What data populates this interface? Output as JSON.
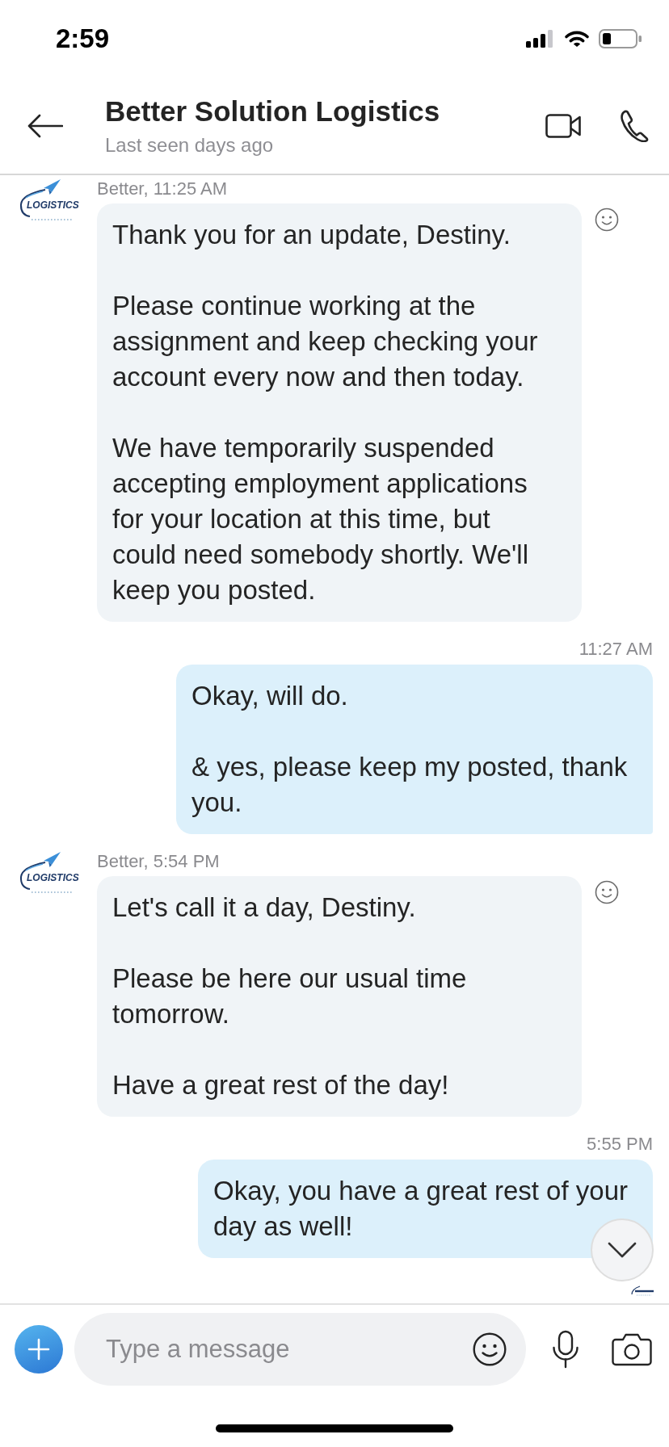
{
  "status_bar": {
    "time": "2:59"
  },
  "header": {
    "title": "Better Solution Logistics",
    "subtitle": "Last seen days ago"
  },
  "messages": [
    {
      "kind": "incoming",
      "meta": "Better, 11:25 AM",
      "avatar_text": "LOGISTICS",
      "text": "Thank you for an update, Destiny.\n\nPlease continue working at the assignment and keep checking your account every now and then today.\n\nWe have temporarily suspended accepting employment applications for your location at this time, but could need somebody shortly. We'll keep you posted."
    },
    {
      "kind": "outgoing",
      "meta": "11:27 AM",
      "text": "Okay, will do.\n\n& yes, please keep my posted, thank you."
    },
    {
      "kind": "incoming",
      "meta": "Better, 5:54 PM",
      "avatar_text": "LOGISTICS",
      "text": "Let's call it a day, Destiny.\n\nPlease be here our usual time tomorrow.\n\nHave a great rest of the day!"
    },
    {
      "kind": "outgoing",
      "meta": "5:55 PM",
      "text": "Okay, you have a great rest of your day as well!"
    }
  ],
  "composer": {
    "placeholder": "Type a message"
  }
}
